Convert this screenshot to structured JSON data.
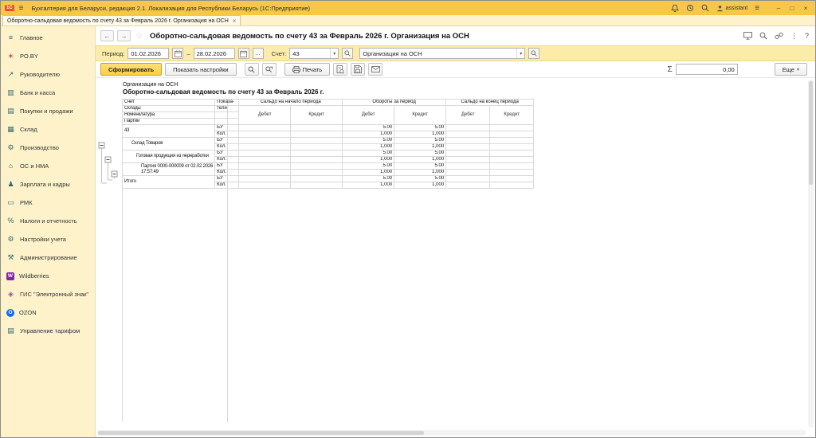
{
  "titlebar": {
    "logo": "1С",
    "title": "Бухгалтерия для Беларуси, редакция 2.1. Локализация для Республики Беларусь  (1С:Предприятие)",
    "user_name": "assistant"
  },
  "glyphs": {
    "back": "←",
    "forward": "→",
    "favorite": "☆",
    "dropdown": "▾",
    "dots": "...",
    "dash": "–",
    "sigma": "Σ",
    "kebab": "⋮",
    "help": "?",
    "menu": "≡",
    "minimize": "–",
    "maximize": "□",
    "close": "×"
  },
  "tab": {
    "label": "Оборотно-сальдовая ведомость по счету 43 за Февраль 2026 г. Организация на ОСН"
  },
  "sidebar": {
    "items": [
      {
        "label": "Главное",
        "icon": "home-icon",
        "glyph": "≡"
      },
      {
        "label": "PO.BY",
        "icon": "poby-icon",
        "glyph": "∗"
      },
      {
        "label": "Руководителю",
        "icon": "manager-icon",
        "glyph": "↗"
      },
      {
        "label": "Банк и касса",
        "icon": "bank-icon",
        "glyph": "▥"
      },
      {
        "label": "Покупки и продажи",
        "icon": "trade-icon",
        "glyph": "▤"
      },
      {
        "label": "Склад",
        "icon": "warehouse-icon",
        "glyph": "▦"
      },
      {
        "label": "Производство",
        "icon": "production-icon",
        "glyph": "⚙"
      },
      {
        "label": "ОС и НМА",
        "icon": "fixed-assets-icon",
        "glyph": "⌂"
      },
      {
        "label": "Зарплата и кадры",
        "icon": "payroll-icon",
        "glyph": "♟"
      },
      {
        "label": "РМК",
        "icon": "pos-icon",
        "glyph": "▭"
      },
      {
        "label": "Налоги и отчетность",
        "icon": "taxes-icon",
        "glyph": "%"
      },
      {
        "label": "Настройки учета",
        "icon": "accounting-settings-icon",
        "glyph": "⚙"
      },
      {
        "label": "Администрирование",
        "icon": "administration-icon",
        "glyph": "⚒"
      },
      {
        "label": "Wildberries",
        "icon": "wildberries-icon",
        "glyph": "W"
      },
      {
        "label": "ГИС \"Электронный знак\"",
        "icon": "gis-mark-icon",
        "glyph": "◈"
      },
      {
        "label": "OZON",
        "icon": "ozon-icon",
        "glyph": "O"
      },
      {
        "label": "Управление тарифом",
        "icon": "tariff-icon",
        "glyph": "▤"
      }
    ]
  },
  "form": {
    "title": "Оборотно-сальдовая ведомость по счету 43 за Февраль 2026 г. Организация на ОСН"
  },
  "filters": {
    "period_label": "Период:",
    "period_from": "01.02.2026",
    "period_to": "28.02.2026",
    "account_label": "Счет:",
    "account_value": "43",
    "org_value": "Организация на ОСН"
  },
  "actions": {
    "generate": "Сформировать",
    "show_settings": "Показать настройки",
    "print": "Печать",
    "more": "Еще",
    "sum_value": "0,00"
  },
  "report": {
    "org": "Организация на ОСН",
    "heading": "Оборотно-сальдовая ведомость по счету 43 за Февраль 2026 г.",
    "table": {
      "h_account": "Счет",
      "h_sub1": "Склады",
      "h_sub2": "Номенклатура",
      "h_sub3": "Партии",
      "h_ind1": "Показа-",
      "h_ind2": "тели",
      "h_opening": "Сальдо на начало периода",
      "h_turnover": "Обороты за период",
      "h_closing": "Сальдо на конец периода",
      "h_debit": "Дебет",
      "h_credit": "Кредит",
      "ind_bu": "БУ",
      "ind_qty": "Кол.",
      "rows": [
        {
          "label": "43",
          "bu_debit": "5.00",
          "bu_credit": "5.00",
          "qty_debit": "1,000",
          "qty_credit": "1,000"
        },
        {
          "label": "Склад Товаров",
          "bu_debit": "5.00",
          "bu_credit": "5.00",
          "qty_debit": "1,000",
          "qty_credit": "1,000"
        },
        {
          "label": "Готовая продукция из переработки",
          "bu_debit": "5.00",
          "bu_credit": "5.00",
          "qty_debit": "1,000",
          "qty_credit": "1,000"
        },
        {
          "label": "Партия 0000-000009 от 02.02.2026",
          "label2": "17:57:49",
          "bu_debit": "5.00",
          "bu_credit": "5.00",
          "qty_debit": "1,000",
          "qty_credit": "1,000"
        },
        {
          "label": "Итого",
          "bu_debit": "5.00",
          "bu_credit": "5.00",
          "qty_debit": "1,000",
          "qty_credit": "1,000"
        }
      ]
    }
  }
}
